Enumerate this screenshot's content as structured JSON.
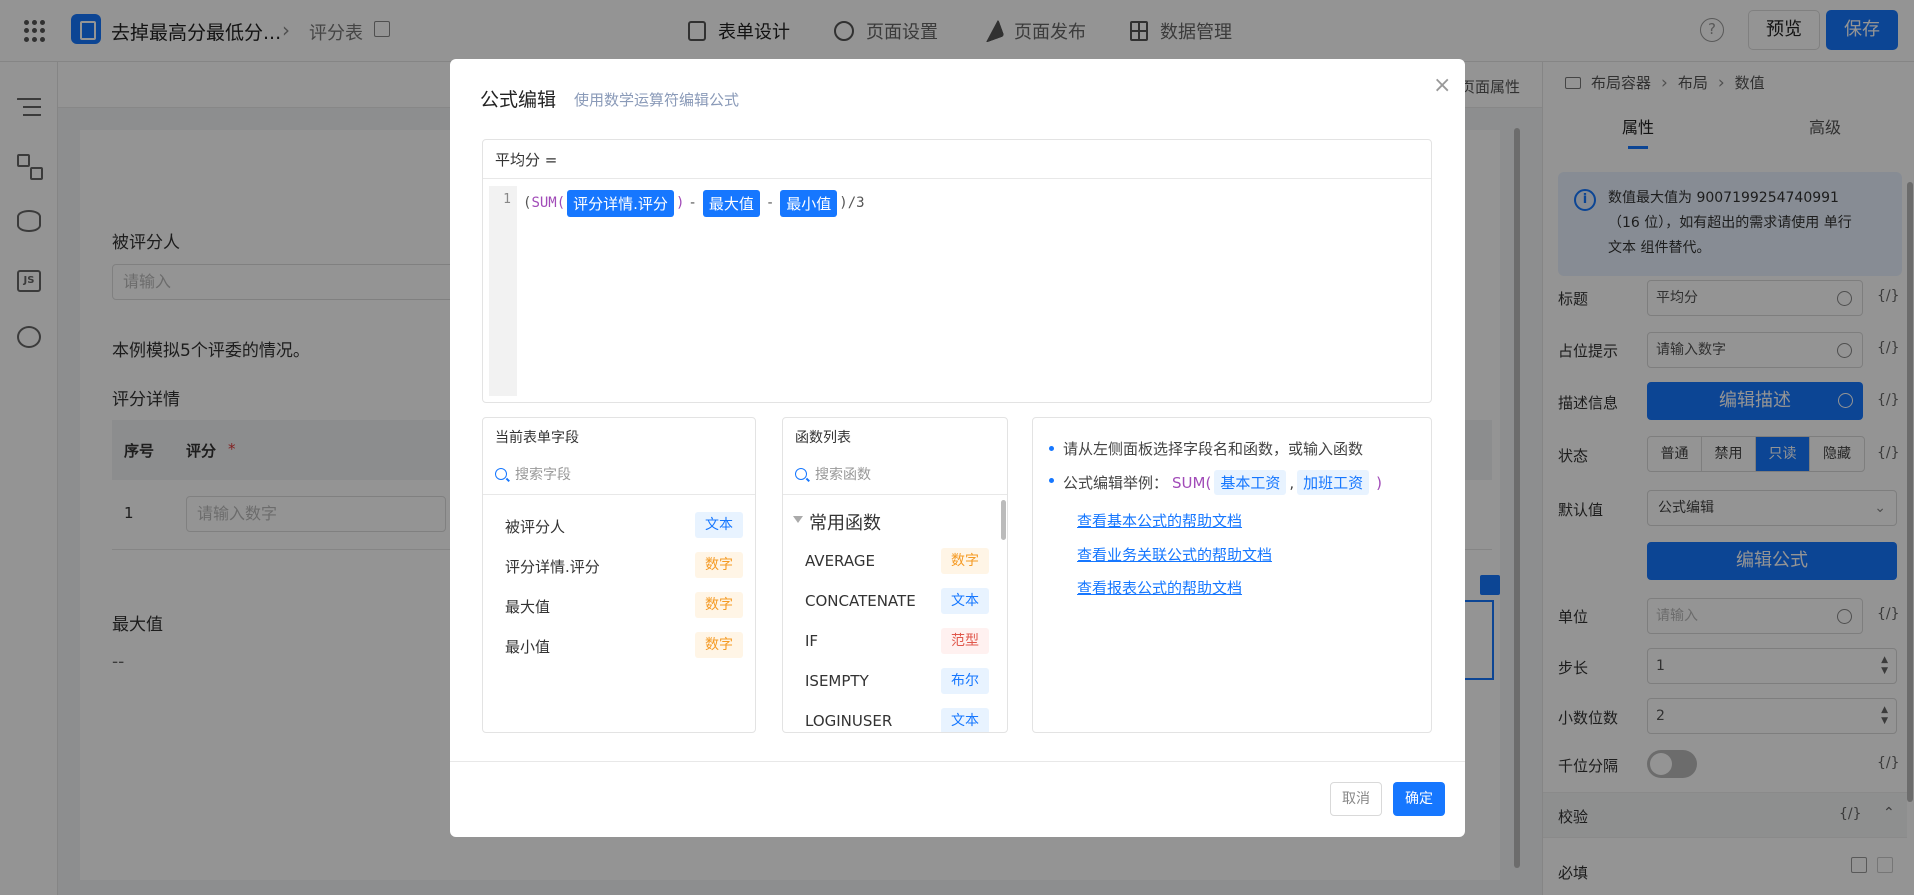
{
  "topbar": {
    "app_name": "去掉最高分最低分...",
    "form_name": "评分表",
    "nav": [
      "表单设计",
      "页面设置",
      "页面发布",
      "数据管理"
    ],
    "help": "?",
    "preview": "预览",
    "save": "保存"
  },
  "canvas": {
    "page_attr": "页面属性",
    "field1_label": "被评分人",
    "field1_placeholder": "请输入",
    "note": "本例模拟5个评委的情况。",
    "subtable_title": "评分详情",
    "col_index": "序号",
    "col_score": "评分",
    "required_mark": "*",
    "row_index": "1",
    "row_placeholder": "请输入数字",
    "max_label": "最大值",
    "max_value": "--"
  },
  "right_panel": {
    "breadcrumb": [
      "布局容器",
      "布局",
      "数值"
    ],
    "tabs": [
      "属性",
      "高级"
    ],
    "info_line1": "数值最大值为 9007199254740991",
    "info_line2": "（16 位），如有超出的需求请使用 单行",
    "info_line3": "文本 组件替代。",
    "title_label": "标题",
    "title_value": "平均分",
    "placeholder_label": "占位提示",
    "placeholder_value": "请输入数字",
    "desc_label": "描述信息",
    "desc_button": "编辑描述",
    "state_label": "状态",
    "states": [
      "普通",
      "禁用",
      "只读",
      "隐藏"
    ],
    "default_label": "默认值",
    "default_value": "公式编辑",
    "formula_button": "编辑公式",
    "unit_label": "单位",
    "unit_placeholder": "请输入",
    "step_label": "步长",
    "step_value": "1",
    "decimal_label": "小数位数",
    "decimal_value": "2",
    "thousands_label": "千位分隔",
    "fx": "{/}",
    "validate_label": "校验",
    "required_label": "必填"
  },
  "modal": {
    "title": "公式编辑",
    "subtitle": "使用数学运算符编辑公式",
    "close": "×",
    "target": "平均分 =",
    "line_no": "1",
    "code": {
      "open": "(",
      "fn": "SUM(",
      "t1": "评分详情.评分",
      "close_fn": ")",
      "minus1": "-",
      "t2": "最大值",
      "minus2": "-",
      "t3": "最小值",
      "tail": ")/3"
    },
    "fields_panel": {
      "title": "当前表单字段",
      "search_placeholder": "搜索字段",
      "items": [
        {
          "name": "被评分人",
          "type": "文本"
        },
        {
          "name": "评分详情.评分",
          "type": "数字"
        },
        {
          "name": "最大值",
          "type": "数字"
        },
        {
          "name": "最小值",
          "type": "数字"
        }
      ]
    },
    "functions_panel": {
      "title": "函数列表",
      "search_placeholder": "搜索函数",
      "group": "常用函数",
      "items": [
        {
          "name": "AVERAGE",
          "type": "数字"
        },
        {
          "name": "CONCATENATE",
          "type": "文本"
        },
        {
          "name": "IF",
          "type": "范型"
        },
        {
          "name": "ISEMPTY",
          "type": "布尔"
        },
        {
          "name": "LOGINUSER",
          "type": "文本"
        }
      ]
    },
    "help": {
      "tip1": "请从左侧面板选择字段名和函数，或输入函数",
      "tip2_prefix": "公式编辑举例：",
      "tip2_fn": "SUM(",
      "tip2_a": "基本工资",
      "tip2_comma": ",",
      "tip2_b": "加班工资",
      "tip2_end": ")",
      "links": [
        "查看基本公式的帮助文档",
        "查看业务关联公式的帮助文档",
        "查看报表公式的帮助文档"
      ]
    },
    "cancel": "取消",
    "ok": "确定"
  }
}
